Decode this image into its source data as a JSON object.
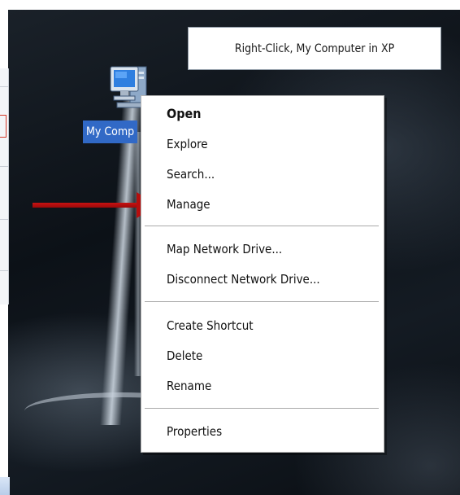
{
  "caption": {
    "text": "Right-Click, My Computer in XP"
  },
  "desktop_icon": {
    "label": "My Comp",
    "icon": "my-computer-icon"
  },
  "context_menu": {
    "items": [
      {
        "label": "Open",
        "bold": true
      },
      {
        "label": "Explore"
      },
      {
        "label": "Search..."
      },
      {
        "label": "Manage",
        "highlighted_by_arrow": true
      },
      {
        "label": "Map Network Drive..."
      },
      {
        "label": "Disconnect Network Drive..."
      },
      {
        "label": "Create Shortcut"
      },
      {
        "label": "Delete"
      },
      {
        "label": "Rename"
      },
      {
        "label": "Properties"
      }
    ]
  },
  "colors": {
    "selection_highlight": "#3169c6",
    "arrow": "#b50e0e",
    "menu_background": "#ffffff"
  }
}
